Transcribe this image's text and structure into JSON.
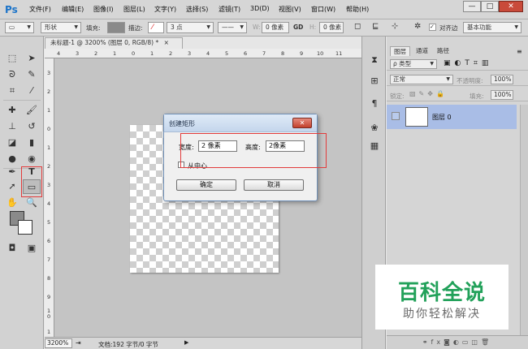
{
  "app": {
    "logo": "Ps"
  },
  "menu": [
    "文件(F)",
    "编辑(E)",
    "图像(I)",
    "图层(L)",
    "文字(Y)",
    "选择(S)",
    "滤镜(T)",
    "3D(D)",
    "视图(V)",
    "窗口(W)",
    "帮助(H)"
  ],
  "window_controls": {
    "minimize": "—",
    "maximize": "□",
    "close": "✕"
  },
  "options": {
    "shape_mode": "形状",
    "fill_label": "填充:",
    "stroke_label": "描边:",
    "stroke_size": "3 点",
    "w_label": "W:",
    "w_value": "0 像素",
    "link": "GD",
    "h_label": "H:",
    "h_value": "0 像素",
    "align_edges": "对齐边",
    "workspace": "基本功能"
  },
  "document": {
    "tab_title": "未标题-1 @ 3200% (图层 0, RGB/8) *",
    "tab_close": "×",
    "ruler_top": [
      "4",
      "3",
      "2",
      "1",
      "0",
      "1",
      "2",
      "3",
      "4",
      "5",
      "6",
      "7",
      "8",
      "9",
      "10",
      "11"
    ],
    "ruler_left": [
      "3",
      "2",
      "1",
      "0",
      "1",
      "2",
      "3",
      "4",
      "5",
      "6",
      "7",
      "8",
      "9",
      "1\n0",
      "1"
    ],
    "zoom": "3200%",
    "doc_info": "文档:192 字节/0 字节"
  },
  "dialog": {
    "title": "创建矩形",
    "close": "✕",
    "width_label": "宽度:",
    "width_value": "2 像素",
    "height_label": "高度:",
    "height_value": "2像素",
    "from_center_label": "从中心",
    "from_center_checked": false,
    "ok_label": "确定",
    "cancel_label": "取消"
  },
  "layers_panel": {
    "tabs": [
      "图层",
      "通道",
      "路径"
    ],
    "active_tab": "图层",
    "filter": "ρ 类型",
    "blend_mode": "正常",
    "opacity_label": "不透明度:",
    "opacity_value": "100%",
    "lock_label": "锁定:",
    "fill_label": "填充:",
    "fill_value": "100%",
    "layers": [
      {
        "name": "图层 0"
      }
    ]
  },
  "watermark": {
    "title": "百科全说",
    "subtitle": "助你轻松解决"
  },
  "colors": {
    "accent": "#1c74c9",
    "annotation": "#e23b3b",
    "layer_selected": "#a9bde6",
    "watermark_green": "#22a15a"
  }
}
